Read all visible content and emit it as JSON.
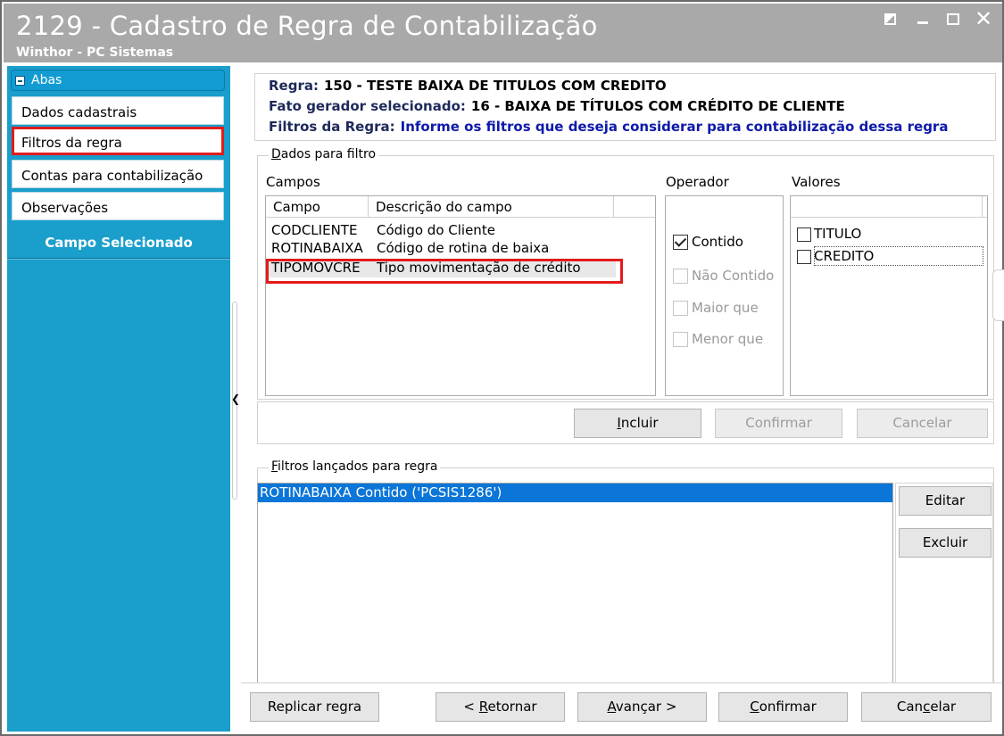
{
  "window": {
    "title": "2129 - Cadastro de Regra de Contabilização",
    "subtitle": "Winthor - PC Sistemas"
  },
  "sidebar": {
    "header": "Abas",
    "items": [
      {
        "label": "Dados cadastrais"
      },
      {
        "label": "Filtros da regra"
      },
      {
        "label": "Contas para contabilização"
      },
      {
        "label": "Observações"
      }
    ],
    "selected_label": "Campo Selecionado"
  },
  "info": {
    "regra_label": "Regra:",
    "regra_value": "150 - TESTE BAIXA DE TITULOS COM CREDITO",
    "fato_label": "Fato gerador selecionado:",
    "fato_value": "16 - BAIXA DE TÍTULOS COM CRÉDITO DE CLIENTE",
    "filtros_label": "Filtros da Regra:",
    "filtros_value": "Informe os filtros que deseja considerar para contabilização dessa regra"
  },
  "dados_filtro": {
    "title_rest": "ados para filtro",
    "title_hotkey": "D",
    "campos_label": "Campos",
    "columns": [
      "Campo",
      "Descrição do campo"
    ],
    "rows": [
      {
        "campo": "CODCLIENTE",
        "descricao": "Código do Cliente"
      },
      {
        "campo": "ROTINABAIXA",
        "descricao": "Código de rotina de baixa"
      },
      {
        "campo": "TIPOMOVCRE",
        "descricao": "Tipo movimentação de crédito"
      }
    ],
    "operador_label": "Operador",
    "operadores": [
      {
        "label": "Contido",
        "checked": true,
        "enabled": true
      },
      {
        "label": "Não Contido",
        "checked": false,
        "enabled": false
      },
      {
        "label": "Maior que",
        "checked": false,
        "enabled": false
      },
      {
        "label": "Menor que",
        "checked": false,
        "enabled": false
      }
    ],
    "valores_label": "Valores",
    "valores": [
      {
        "label": "TITULO",
        "checked": false
      },
      {
        "label": "CREDITO",
        "checked": false
      }
    ],
    "buttons": {
      "incluir_hotkey": "I",
      "incluir_rest": "ncluir",
      "confirmar": "Confirmar",
      "cancelar": "Cancelar"
    }
  },
  "filtros_lancados": {
    "title_hotkey": "F",
    "title_rest": "iltros lançados para regra",
    "items": [
      "ROTINABAIXA Contido ('PCSIS1286')"
    ],
    "editar": "Editar",
    "excluir": "Excluir"
  },
  "footer": {
    "replicar": "Replicar regra",
    "retornar_pre": "< ",
    "retornar_hotkey": "R",
    "retornar_rest": "etornar",
    "avancar_hotkey": "A",
    "avancar_rest": "vançar >",
    "confirmar_hotkey": "C",
    "confirmar_rest": "onfirmar",
    "cancelar_pre": "Can",
    "cancelar_hotkey": "c",
    "cancelar_rest": "elar"
  },
  "colors": {
    "title_bar": "#a9a9a9",
    "sidebar": "#1a9ecb",
    "highlight": "#e31b1b",
    "selection": "#0b76d8",
    "info_value_blue": "#0e1aa8"
  }
}
